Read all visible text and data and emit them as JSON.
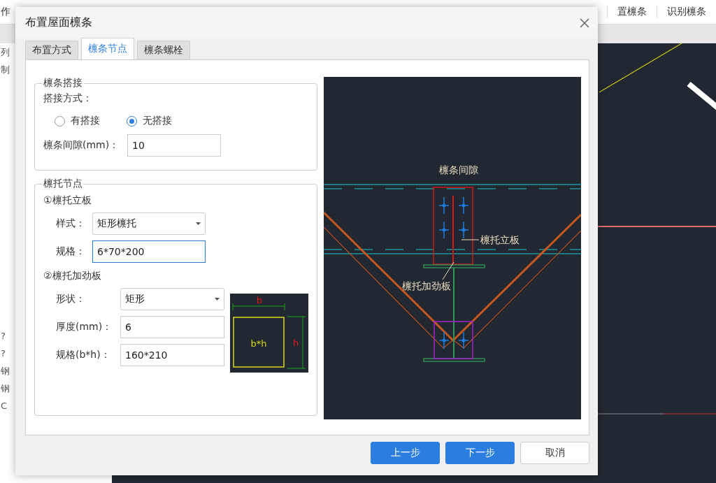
{
  "background_app": {
    "toolbar": [
      {
        "label": "作"
      },
      {
        "label": "置檩条"
      },
      {
        "label": "识别檩条"
      }
    ],
    "left_panel": [
      {
        "label": "列"
      },
      {
        "label": "制"
      },
      {
        "label": "?"
      },
      {
        "label": "?"
      },
      {
        "label": "钢"
      },
      {
        "label": "钢"
      },
      {
        "label": "C"
      }
    ]
  },
  "dialog": {
    "title": "布置屋面檩条",
    "tabs": [
      {
        "label": "布置方式",
        "selected": false
      },
      {
        "label": "檩条节点",
        "selected": true
      },
      {
        "label": "檩条螺栓",
        "selected": false
      }
    ],
    "overlap_group": {
      "title": "檩条搭接",
      "method_label": "搭接方式：",
      "options": [
        {
          "label": "有搭接",
          "selected": false
        },
        {
          "label": "无搭接",
          "selected": true
        }
      ],
      "gap_label": "檩条间隙(mm)：",
      "gap_value": "10"
    },
    "bracket_group": {
      "title": "檩托节点",
      "vertical_plate": {
        "heading": "①檩托立板",
        "style_label": "样式：",
        "style_value": "矩形檩托",
        "spec_label": "规格：",
        "spec_value": "6*70*200",
        "spec_focused": true
      },
      "stiffener": {
        "heading": "②檩托加劲板",
        "shape_label": "形状：",
        "shape_value": "矩形",
        "thickness_label": "厚度(mm)：",
        "thickness_value": "6",
        "spec_label": "规格(b*h)：",
        "spec_value": "160*210",
        "preview": {
          "width_label": "b",
          "height_label": "h",
          "center_label": "b*h"
        }
      }
    },
    "diagram_labels": {
      "gap": "檩条间隙",
      "vertical_plate": "檩托立板",
      "stiffener": "檩托加劲板"
    },
    "buttons": [
      {
        "label": "上一步",
        "kind": "primary"
      },
      {
        "label": "下一步",
        "kind": "primary"
      },
      {
        "label": "取消",
        "kind": "secondary"
      }
    ]
  }
}
